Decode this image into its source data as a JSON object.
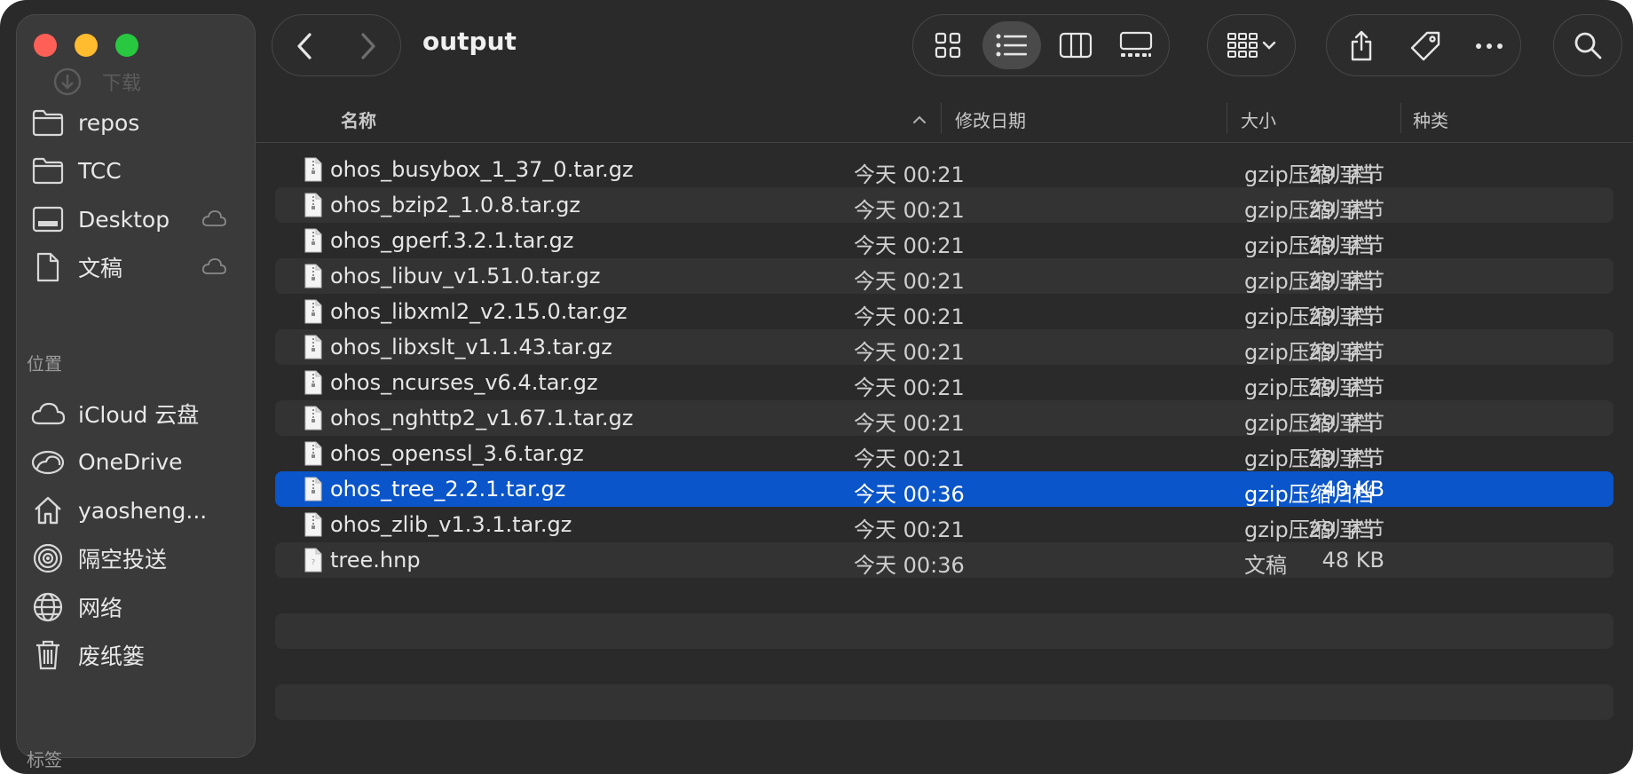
{
  "window": {
    "title": "output"
  },
  "sidebar": {
    "ghost_item": "下载",
    "favorites": [
      {
        "label": "repos",
        "icon": "folder-icon",
        "cloud": false
      },
      {
        "label": "TCC",
        "icon": "folder-icon",
        "cloud": false
      },
      {
        "label": "Desktop",
        "icon": "desktop-icon",
        "cloud": true
      },
      {
        "label": "文稿",
        "icon": "document-icon",
        "cloud": true
      }
    ],
    "locations_header": "位置",
    "locations": [
      {
        "label": "iCloud 云盘",
        "icon": "icloud-icon"
      },
      {
        "label": "OneDrive",
        "icon": "onedrive-icon"
      },
      {
        "label": "yaosheng...",
        "icon": "home-icon"
      },
      {
        "label": "隔空投送",
        "icon": "airdrop-icon"
      },
      {
        "label": "网络",
        "icon": "network-icon"
      },
      {
        "label": "废纸篓",
        "icon": "trash-icon"
      }
    ],
    "tags_header": "标签"
  },
  "columns": {
    "name": "名称",
    "date": "修改日期",
    "size": "大小",
    "kind": "种类"
  },
  "files": [
    {
      "name": "ohos_busybox_1_37_0.tar.gz",
      "date": "今天 00:21",
      "size": "29 字节",
      "kind": "gzip压缩归档",
      "selected": false
    },
    {
      "name": "ohos_bzip2_1.0.8.tar.gz",
      "date": "今天 00:21",
      "size": "29 字节",
      "kind": "gzip压缩归档",
      "selected": false
    },
    {
      "name": "ohos_gperf.3.2.1.tar.gz",
      "date": "今天 00:21",
      "size": "29 字节",
      "kind": "gzip压缩归档",
      "selected": false
    },
    {
      "name": "ohos_libuv_v1.51.0.tar.gz",
      "date": "今天 00:21",
      "size": "29 字节",
      "kind": "gzip压缩归档",
      "selected": false
    },
    {
      "name": "ohos_libxml2_v2.15.0.tar.gz",
      "date": "今天 00:21",
      "size": "29 字节",
      "kind": "gzip压缩归档",
      "selected": false
    },
    {
      "name": "ohos_libxslt_v1.1.43.tar.gz",
      "date": "今天 00:21",
      "size": "29 字节",
      "kind": "gzip压缩归档",
      "selected": false
    },
    {
      "name": "ohos_ncurses_v6.4.tar.gz",
      "date": "今天 00:21",
      "size": "29 字节",
      "kind": "gzip压缩归档",
      "selected": false
    },
    {
      "name": "ohos_nghttp2_v1.67.1.tar.gz",
      "date": "今天 00:21",
      "size": "29 字节",
      "kind": "gzip压缩归档",
      "selected": false
    },
    {
      "name": "ohos_openssl_3.6.tar.gz",
      "date": "今天 00:21",
      "size": "29 字节",
      "kind": "gzip压缩归档",
      "selected": false
    },
    {
      "name": "ohos_tree_2.2.1.tar.gz",
      "date": "今天 00:36",
      "size": "49 KB",
      "kind": "gzip压缩归档",
      "selected": true
    },
    {
      "name": "ohos_zlib_v1.3.1.tar.gz",
      "date": "今天 00:21",
      "size": "29 字节",
      "kind": "gzip压缩归档",
      "selected": false
    },
    {
      "name": "tree.hnp",
      "date": "今天 00:36",
      "size": "48 KB",
      "kind": "文稿",
      "selected": false
    }
  ],
  "colors": {
    "selection": "#0a55c9",
    "window_bg": "#2a2a2a",
    "sidebar_bg": "#3a3a3a"
  }
}
